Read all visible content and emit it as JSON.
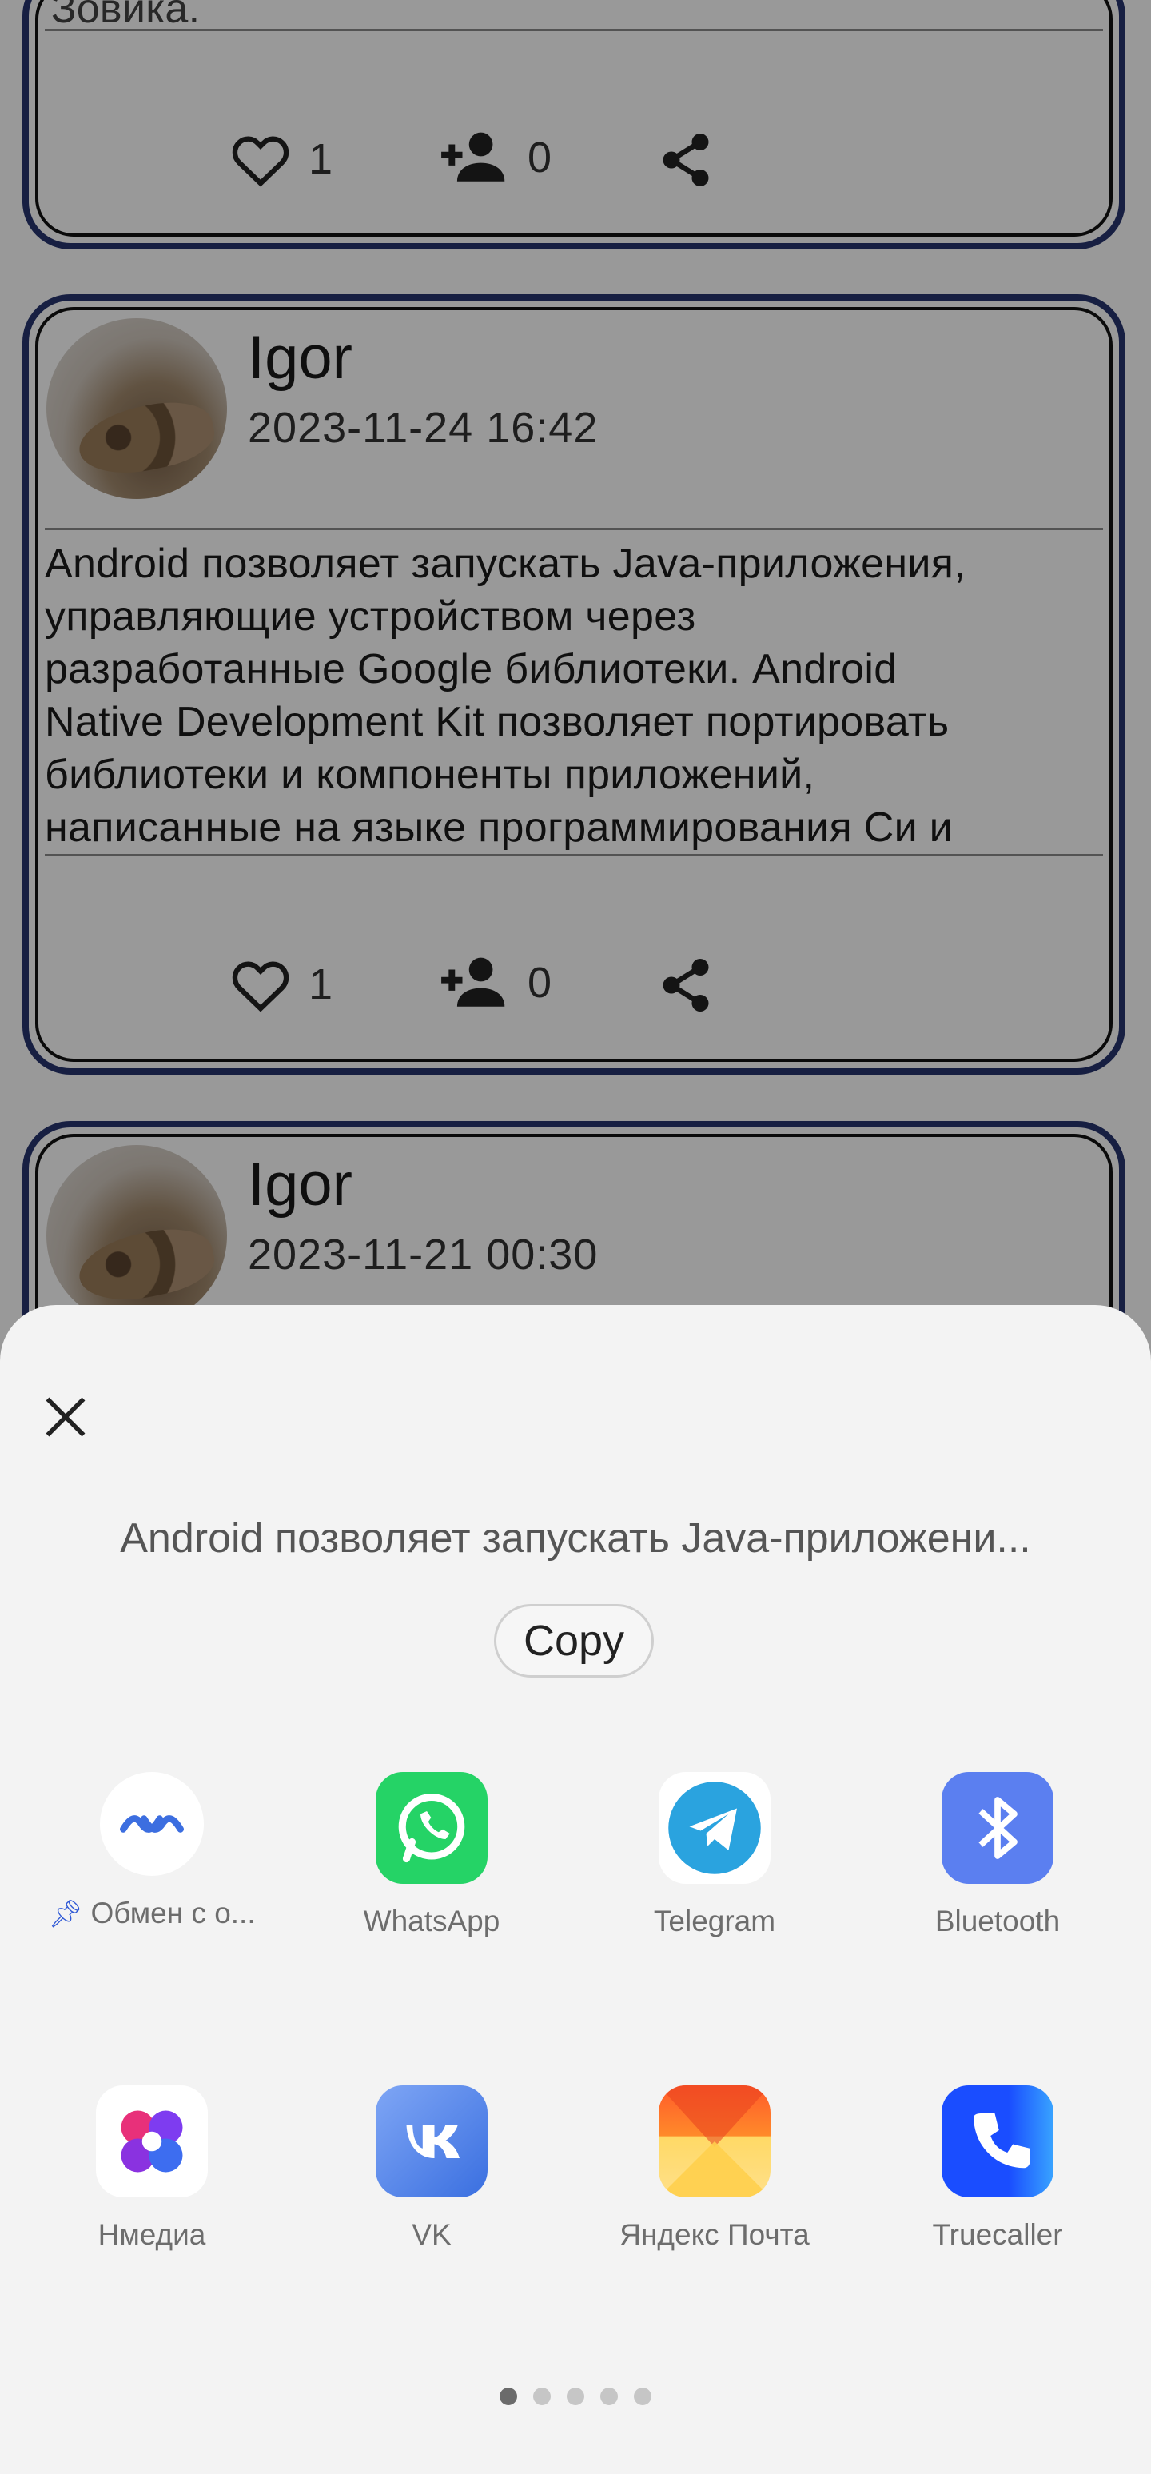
{
  "feed": {
    "top_card": {
      "partial_text": "Зовика.",
      "likes": "1",
      "followers": "0"
    },
    "card2": {
      "author": "Igor",
      "date": "2023-11-24 16:42",
      "text_lines": [
        "Android позволяет запускать Java-приложения,",
        "управляющие устройством через",
        "разработанные Google библиотеки. Android",
        "Native Development Kit позволяет портировать",
        "библиотеки и компоненты приложений,",
        "написанные на языке программирования Си и"
      ],
      "likes": "1",
      "followers": "0"
    },
    "card3": {
      "author": "Igor",
      "date": "2023-11-21 00:30"
    }
  },
  "share_sheet": {
    "preview_text": "Android позволяет запускать Java-приложени...",
    "copy_label": "Copy",
    "apps": [
      {
        "name": "obmen",
        "label": "Обмен с о...",
        "pinned": true
      },
      {
        "name": "whatsapp",
        "label": "WhatsApp"
      },
      {
        "name": "telegram",
        "label": "Telegram"
      },
      {
        "name": "bluetooth",
        "label": "Bluetooth"
      },
      {
        "name": "nmedia",
        "label": "Нмедиа"
      },
      {
        "name": "vk",
        "label": "VK"
      },
      {
        "name": "yandex-mail",
        "label": "Яндекс Почта"
      },
      {
        "name": "truecaller",
        "label": "Truecaller"
      }
    ],
    "page_indicator": {
      "pages": 5,
      "current": 1
    }
  },
  "colors": {
    "card_border": "#27346e",
    "whatsapp": "#25d366",
    "telegram": "#2aa3df",
    "bluetooth": "#5b7ff0",
    "truecaller": "#1a4dff"
  }
}
